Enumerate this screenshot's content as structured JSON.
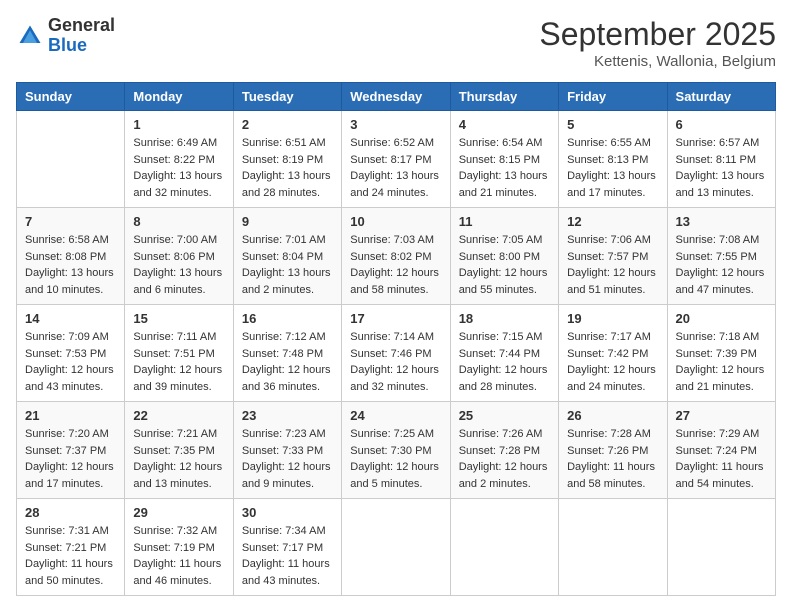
{
  "logo": {
    "general": "General",
    "blue": "Blue"
  },
  "title": "September 2025",
  "subtitle": "Kettenis, Wallonia, Belgium",
  "days": [
    "Sunday",
    "Monday",
    "Tuesday",
    "Wednesday",
    "Thursday",
    "Friday",
    "Saturday"
  ],
  "weeks": [
    [
      {
        "day": "",
        "sunrise": "",
        "sunset": "",
        "daylight": ""
      },
      {
        "day": "1",
        "sunrise": "Sunrise: 6:49 AM",
        "sunset": "Sunset: 8:22 PM",
        "daylight": "Daylight: 13 hours and 32 minutes."
      },
      {
        "day": "2",
        "sunrise": "Sunrise: 6:51 AM",
        "sunset": "Sunset: 8:19 PM",
        "daylight": "Daylight: 13 hours and 28 minutes."
      },
      {
        "day": "3",
        "sunrise": "Sunrise: 6:52 AM",
        "sunset": "Sunset: 8:17 PM",
        "daylight": "Daylight: 13 hours and 24 minutes."
      },
      {
        "day": "4",
        "sunrise": "Sunrise: 6:54 AM",
        "sunset": "Sunset: 8:15 PM",
        "daylight": "Daylight: 13 hours and 21 minutes."
      },
      {
        "day": "5",
        "sunrise": "Sunrise: 6:55 AM",
        "sunset": "Sunset: 8:13 PM",
        "daylight": "Daylight: 13 hours and 17 minutes."
      },
      {
        "day": "6",
        "sunrise": "Sunrise: 6:57 AM",
        "sunset": "Sunset: 8:11 PM",
        "daylight": "Daylight: 13 hours and 13 minutes."
      }
    ],
    [
      {
        "day": "7",
        "sunrise": "Sunrise: 6:58 AM",
        "sunset": "Sunset: 8:08 PM",
        "daylight": "Daylight: 13 hours and 10 minutes."
      },
      {
        "day": "8",
        "sunrise": "Sunrise: 7:00 AM",
        "sunset": "Sunset: 8:06 PM",
        "daylight": "Daylight: 13 hours and 6 minutes."
      },
      {
        "day": "9",
        "sunrise": "Sunrise: 7:01 AM",
        "sunset": "Sunset: 8:04 PM",
        "daylight": "Daylight: 13 hours and 2 minutes."
      },
      {
        "day": "10",
        "sunrise": "Sunrise: 7:03 AM",
        "sunset": "Sunset: 8:02 PM",
        "daylight": "Daylight: 12 hours and 58 minutes."
      },
      {
        "day": "11",
        "sunrise": "Sunrise: 7:05 AM",
        "sunset": "Sunset: 8:00 PM",
        "daylight": "Daylight: 12 hours and 55 minutes."
      },
      {
        "day": "12",
        "sunrise": "Sunrise: 7:06 AM",
        "sunset": "Sunset: 7:57 PM",
        "daylight": "Daylight: 12 hours and 51 minutes."
      },
      {
        "day": "13",
        "sunrise": "Sunrise: 7:08 AM",
        "sunset": "Sunset: 7:55 PM",
        "daylight": "Daylight: 12 hours and 47 minutes."
      }
    ],
    [
      {
        "day": "14",
        "sunrise": "Sunrise: 7:09 AM",
        "sunset": "Sunset: 7:53 PM",
        "daylight": "Daylight: 12 hours and 43 minutes."
      },
      {
        "day": "15",
        "sunrise": "Sunrise: 7:11 AM",
        "sunset": "Sunset: 7:51 PM",
        "daylight": "Daylight: 12 hours and 39 minutes."
      },
      {
        "day": "16",
        "sunrise": "Sunrise: 7:12 AM",
        "sunset": "Sunset: 7:48 PM",
        "daylight": "Daylight: 12 hours and 36 minutes."
      },
      {
        "day": "17",
        "sunrise": "Sunrise: 7:14 AM",
        "sunset": "Sunset: 7:46 PM",
        "daylight": "Daylight: 12 hours and 32 minutes."
      },
      {
        "day": "18",
        "sunrise": "Sunrise: 7:15 AM",
        "sunset": "Sunset: 7:44 PM",
        "daylight": "Daylight: 12 hours and 28 minutes."
      },
      {
        "day": "19",
        "sunrise": "Sunrise: 7:17 AM",
        "sunset": "Sunset: 7:42 PM",
        "daylight": "Daylight: 12 hours and 24 minutes."
      },
      {
        "day": "20",
        "sunrise": "Sunrise: 7:18 AM",
        "sunset": "Sunset: 7:39 PM",
        "daylight": "Daylight: 12 hours and 21 minutes."
      }
    ],
    [
      {
        "day": "21",
        "sunrise": "Sunrise: 7:20 AM",
        "sunset": "Sunset: 7:37 PM",
        "daylight": "Daylight: 12 hours and 17 minutes."
      },
      {
        "day": "22",
        "sunrise": "Sunrise: 7:21 AM",
        "sunset": "Sunset: 7:35 PM",
        "daylight": "Daylight: 12 hours and 13 minutes."
      },
      {
        "day": "23",
        "sunrise": "Sunrise: 7:23 AM",
        "sunset": "Sunset: 7:33 PM",
        "daylight": "Daylight: 12 hours and 9 minutes."
      },
      {
        "day": "24",
        "sunrise": "Sunrise: 7:25 AM",
        "sunset": "Sunset: 7:30 PM",
        "daylight": "Daylight: 12 hours and 5 minutes."
      },
      {
        "day": "25",
        "sunrise": "Sunrise: 7:26 AM",
        "sunset": "Sunset: 7:28 PM",
        "daylight": "Daylight: 12 hours and 2 minutes."
      },
      {
        "day": "26",
        "sunrise": "Sunrise: 7:28 AM",
        "sunset": "Sunset: 7:26 PM",
        "daylight": "Daylight: 11 hours and 58 minutes."
      },
      {
        "day": "27",
        "sunrise": "Sunrise: 7:29 AM",
        "sunset": "Sunset: 7:24 PM",
        "daylight": "Daylight: 11 hours and 54 minutes."
      }
    ],
    [
      {
        "day": "28",
        "sunrise": "Sunrise: 7:31 AM",
        "sunset": "Sunset: 7:21 PM",
        "daylight": "Daylight: 11 hours and 50 minutes."
      },
      {
        "day": "29",
        "sunrise": "Sunrise: 7:32 AM",
        "sunset": "Sunset: 7:19 PM",
        "daylight": "Daylight: 11 hours and 46 minutes."
      },
      {
        "day": "30",
        "sunrise": "Sunrise: 7:34 AM",
        "sunset": "Sunset: 7:17 PM",
        "daylight": "Daylight: 11 hours and 43 minutes."
      },
      {
        "day": "",
        "sunrise": "",
        "sunset": "",
        "daylight": ""
      },
      {
        "day": "",
        "sunrise": "",
        "sunset": "",
        "daylight": ""
      },
      {
        "day": "",
        "sunrise": "",
        "sunset": "",
        "daylight": ""
      },
      {
        "day": "",
        "sunrise": "",
        "sunset": "",
        "daylight": ""
      }
    ]
  ]
}
